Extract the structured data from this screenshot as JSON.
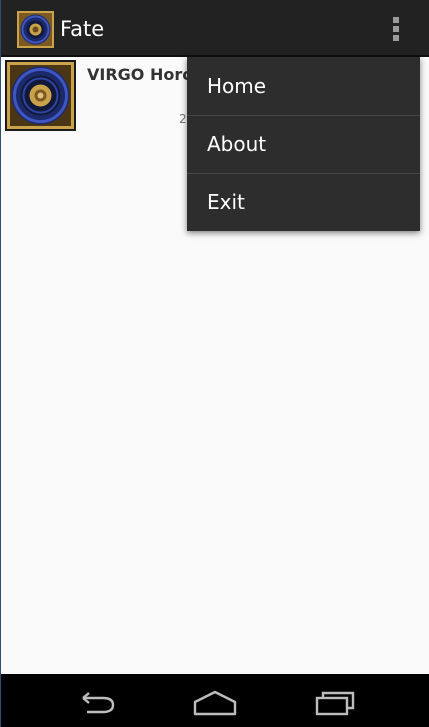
{
  "app": {
    "title": "Fate"
  },
  "action_bar": {
    "icons": [
      "app-icon-zodiac",
      "overflow-menu-icon"
    ]
  },
  "list": {
    "items": [
      {
        "title": "VIRGO Horo",
        "date": "2",
        "icon": "zodiac-wheel-thumbnail"
      }
    ]
  },
  "menu": {
    "items": [
      {
        "label": "Home"
      },
      {
        "label": "About"
      },
      {
        "label": "Exit"
      }
    ]
  },
  "nav_bar": {
    "icons": [
      "back-icon",
      "home-icon",
      "recent-apps-icon"
    ]
  },
  "colors": {
    "action_bar": "#222222",
    "menu_bg": "#2d2d2d",
    "screen_bg": "#fafafa",
    "zodiac_blue": "#2a3f9a",
    "zodiac_gold": "#c9a24a"
  }
}
